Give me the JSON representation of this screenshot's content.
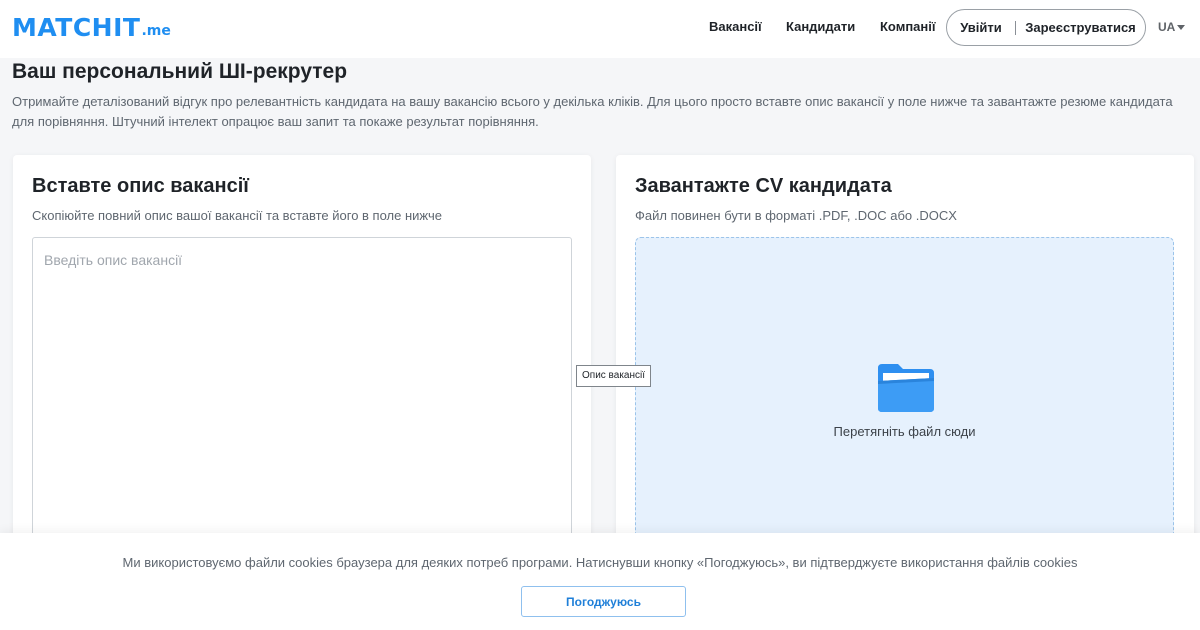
{
  "brand": {
    "logo_main": "MATCHIT",
    "logo_suffix": ".me",
    "accent_color": "#1f8ef1"
  },
  "nav": {
    "vacancies": "Вакансії",
    "candidates": "Кандидати",
    "companies": "Компанії",
    "login": "Увійти",
    "register": "Зареєструватися",
    "language": "UA"
  },
  "hero": {
    "title": "Ваш персональний ШІ-рекрутер",
    "description": "Отримайте деталізований відгук про релевантність кандидата на вашу вакансію всього у декілька кліків. Для цього просто вставте опис вакансії у поле нижче та завантажте резюме кандидата для порівняння. Штучний інтелект опрацює ваш запит та покаже результат порівняння."
  },
  "vacancy_card": {
    "title": "Вставте опис вакансії",
    "subtitle": "Скопіюйте повний опис вашої вакансії та вставте його в поле нижче",
    "placeholder": "Введіть опис вакансії",
    "value": "",
    "tooltip": "Опис вакансії"
  },
  "cv_card": {
    "title": "Завантажте CV кандидата",
    "subtitle": "Файл повинен бути в форматі .PDF, .DOC або .DOCX",
    "drop_text": "Перетягніть файл сюди",
    "icon": "folder-icon",
    "folder_color": "#2e8ff0",
    "dropzone_bg": "#e6f1fd"
  },
  "cookie_banner": {
    "text": "Ми використовуємо файли cookies браузера для деяких потреб програми. Натиснувши кнопку «Погоджуюсь», ви підтверджуєте використання файлів cookies",
    "accept_label": "Погоджуюсь"
  }
}
